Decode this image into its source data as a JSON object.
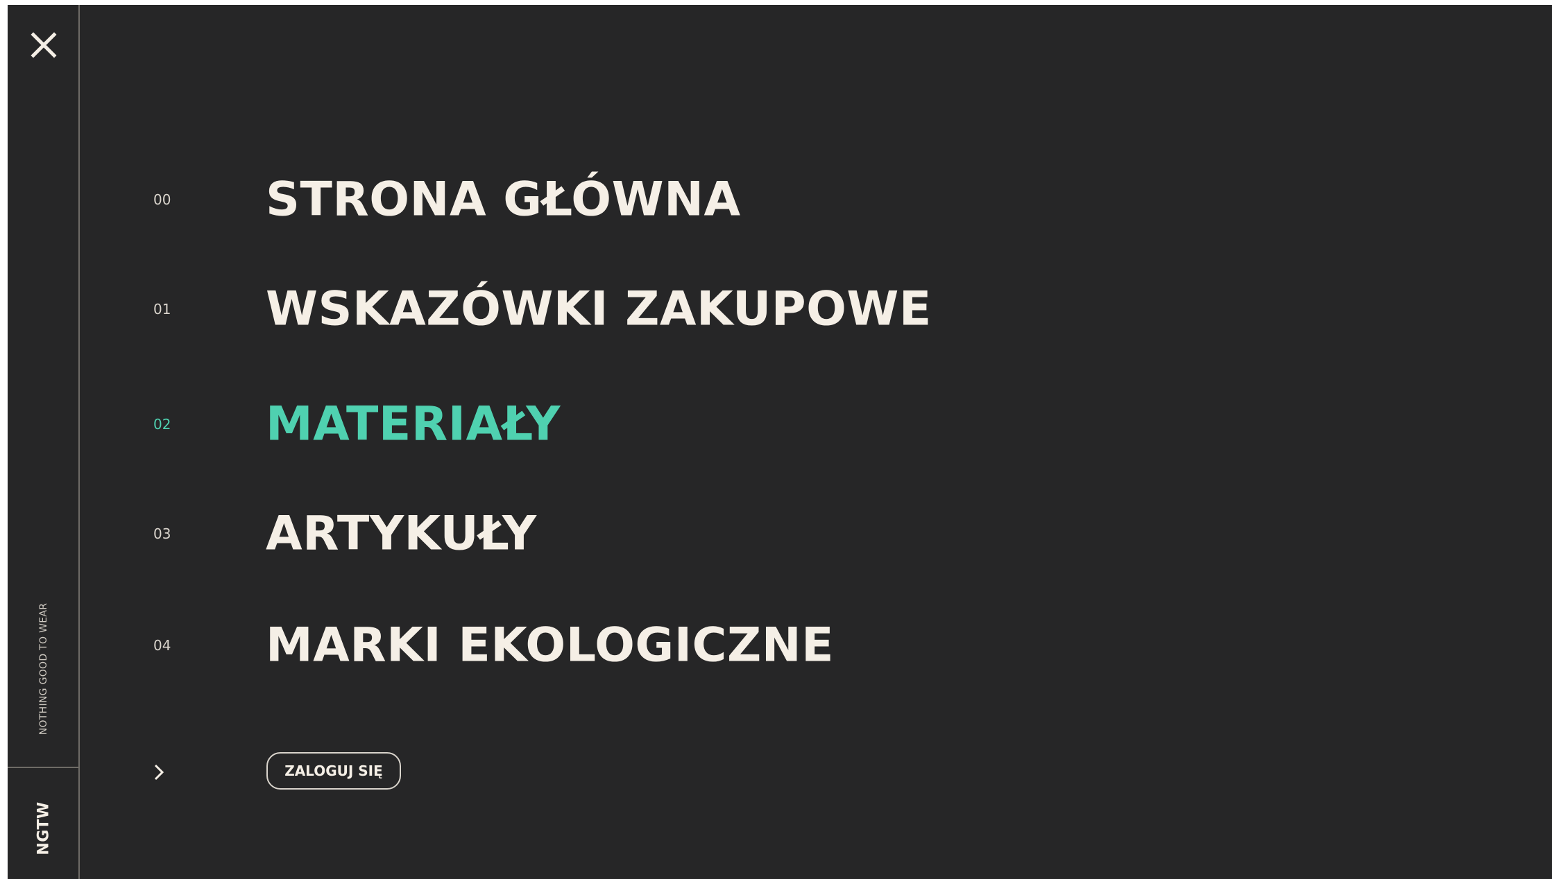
{
  "sidebar": {
    "close_icon": "close-icon",
    "tagline": "NOTHING GOOD TO WEAR",
    "logo": "NGTW"
  },
  "menu": {
    "items": [
      {
        "number": "00",
        "label": "STRONA GŁÓWNA",
        "active": false
      },
      {
        "number": "01",
        "label": "WSKAZÓWKI ZAKUPOWE",
        "active": false
      },
      {
        "number": "02",
        "label": "MATERIAŁY",
        "active": true
      },
      {
        "number": "03",
        "label": "ARTYKUŁY",
        "active": false
      },
      {
        "number": "04",
        "label": "MARKI EKOLOGICZNE",
        "active": false
      }
    ]
  },
  "login": {
    "chevron_icon": "chevron-right-icon",
    "label": "ZALOGUJ SIĘ"
  },
  "colors": {
    "background": "#262627",
    "text": "#f5efe6",
    "accent": "#4fd1b0",
    "divider": "#6e6b66"
  }
}
